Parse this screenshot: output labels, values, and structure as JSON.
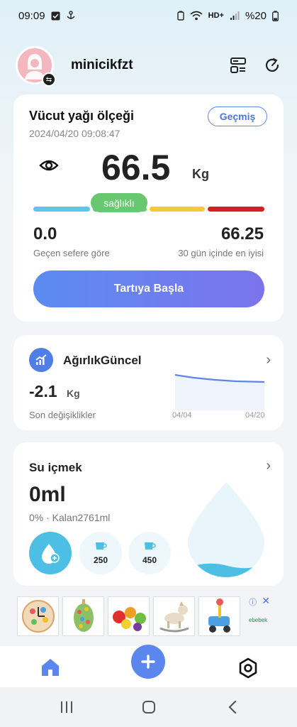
{
  "status_bar": {
    "time": "09:09",
    "network": "HD+",
    "battery": "%20"
  },
  "header": {
    "username": "minicikfzt"
  },
  "scale_card": {
    "title": "Vücut yağı ölçeği",
    "datetime": "2024/04/20 09:08:47",
    "history_label": "Geçmiş",
    "weight": "66.5",
    "unit": "Kg",
    "status": "sağlıklı",
    "status_color": "#67c870",
    "left_value": "0.0",
    "left_label": "Geçen sefere göre",
    "right_value": "66.25",
    "right_label": "30 gün içinde en iyisi",
    "start_label": "Tartıya Başla"
  },
  "trend_card": {
    "title": "AğırlıkGüncel",
    "change": "-2.1",
    "unit": "Kg",
    "label": "Son değişiklikler",
    "x_start": "04/04",
    "x_end": "04/20"
  },
  "water_card": {
    "title": "Su içmek",
    "amount": "0ml",
    "subtitle": "0% · Kalan2761ml",
    "cup1": "250",
    "cup2": "450",
    "progress_fraction": 0.0
  },
  "ad": {
    "brand": "ebebek",
    "info_icon": "info-icon",
    "close_icon": "close-icon"
  },
  "colors": {
    "accent": "#5b86ee",
    "water": "#4dbfe4"
  }
}
